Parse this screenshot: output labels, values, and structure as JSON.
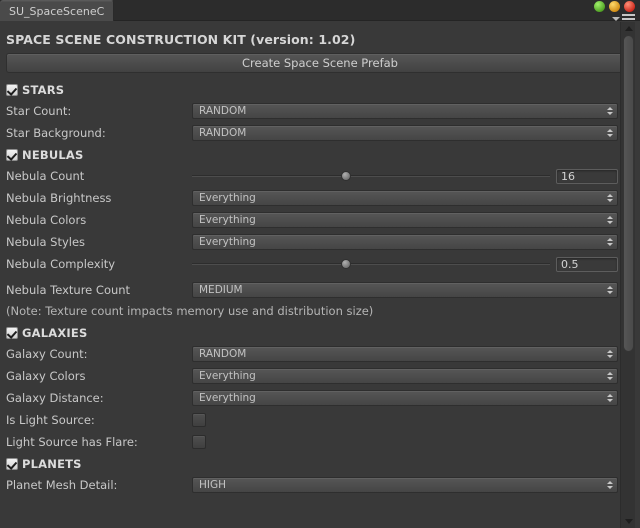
{
  "window": {
    "tab_label": "SU_SpaceSceneC",
    "buttons": [
      {
        "name": "minimize",
        "color": "#6fc22c"
      },
      {
        "name": "maximize",
        "color": "#e0a017"
      },
      {
        "name": "close",
        "color": "#d8372a"
      }
    ],
    "menu_icon": "hamburger-menu-icon"
  },
  "header": {
    "title": "SPACE SCENE CONSTRUCTION KIT (version: 1.02)",
    "create_button": "Create Space Scene Prefab"
  },
  "sections": {
    "stars": {
      "title": "STARS",
      "checked": true,
      "rows": [
        {
          "label": "Star Count:",
          "value": "RANDOM"
        },
        {
          "label": "Star Background:",
          "value": "RANDOM"
        }
      ]
    },
    "nebulas": {
      "title": "NEBULAS",
      "checked": true,
      "count": {
        "label": "Nebula Count",
        "value": "16",
        "slider_pct": 43
      },
      "brightness": {
        "label": "Nebula Brightness",
        "value": "Everything"
      },
      "colors": {
        "label": "Nebula Colors",
        "value": "Everything"
      },
      "styles": {
        "label": "Nebula Styles",
        "value": "Everything"
      },
      "complexity": {
        "label": "Nebula Complexity",
        "value": "0.5",
        "slider_pct": 43
      },
      "texture_count": {
        "label": "Nebula Texture Count",
        "value": "MEDIUM"
      },
      "note": "(Note: Texture count impacts memory use and distribution size)"
    },
    "galaxies": {
      "title": "GALAXIES",
      "checked": true,
      "rows": [
        {
          "label": "Galaxy Count:",
          "value": "RANDOM"
        },
        {
          "label": "Galaxy Colors",
          "value": "Everything"
        },
        {
          "label": "Galaxy Distance:",
          "value": "Everything"
        }
      ],
      "toggles": [
        {
          "label": "Is Light Source:",
          "checked": false
        },
        {
          "label": "Light Source has Flare:",
          "checked": false
        }
      ]
    },
    "planets": {
      "title": "PLANETS",
      "checked": true,
      "rows": [
        {
          "label": "Planet Mesh Detail:",
          "value": "HIGH"
        }
      ]
    }
  },
  "scrollbar": {
    "position_pct": 0,
    "thumb_size_pct": 66
  }
}
